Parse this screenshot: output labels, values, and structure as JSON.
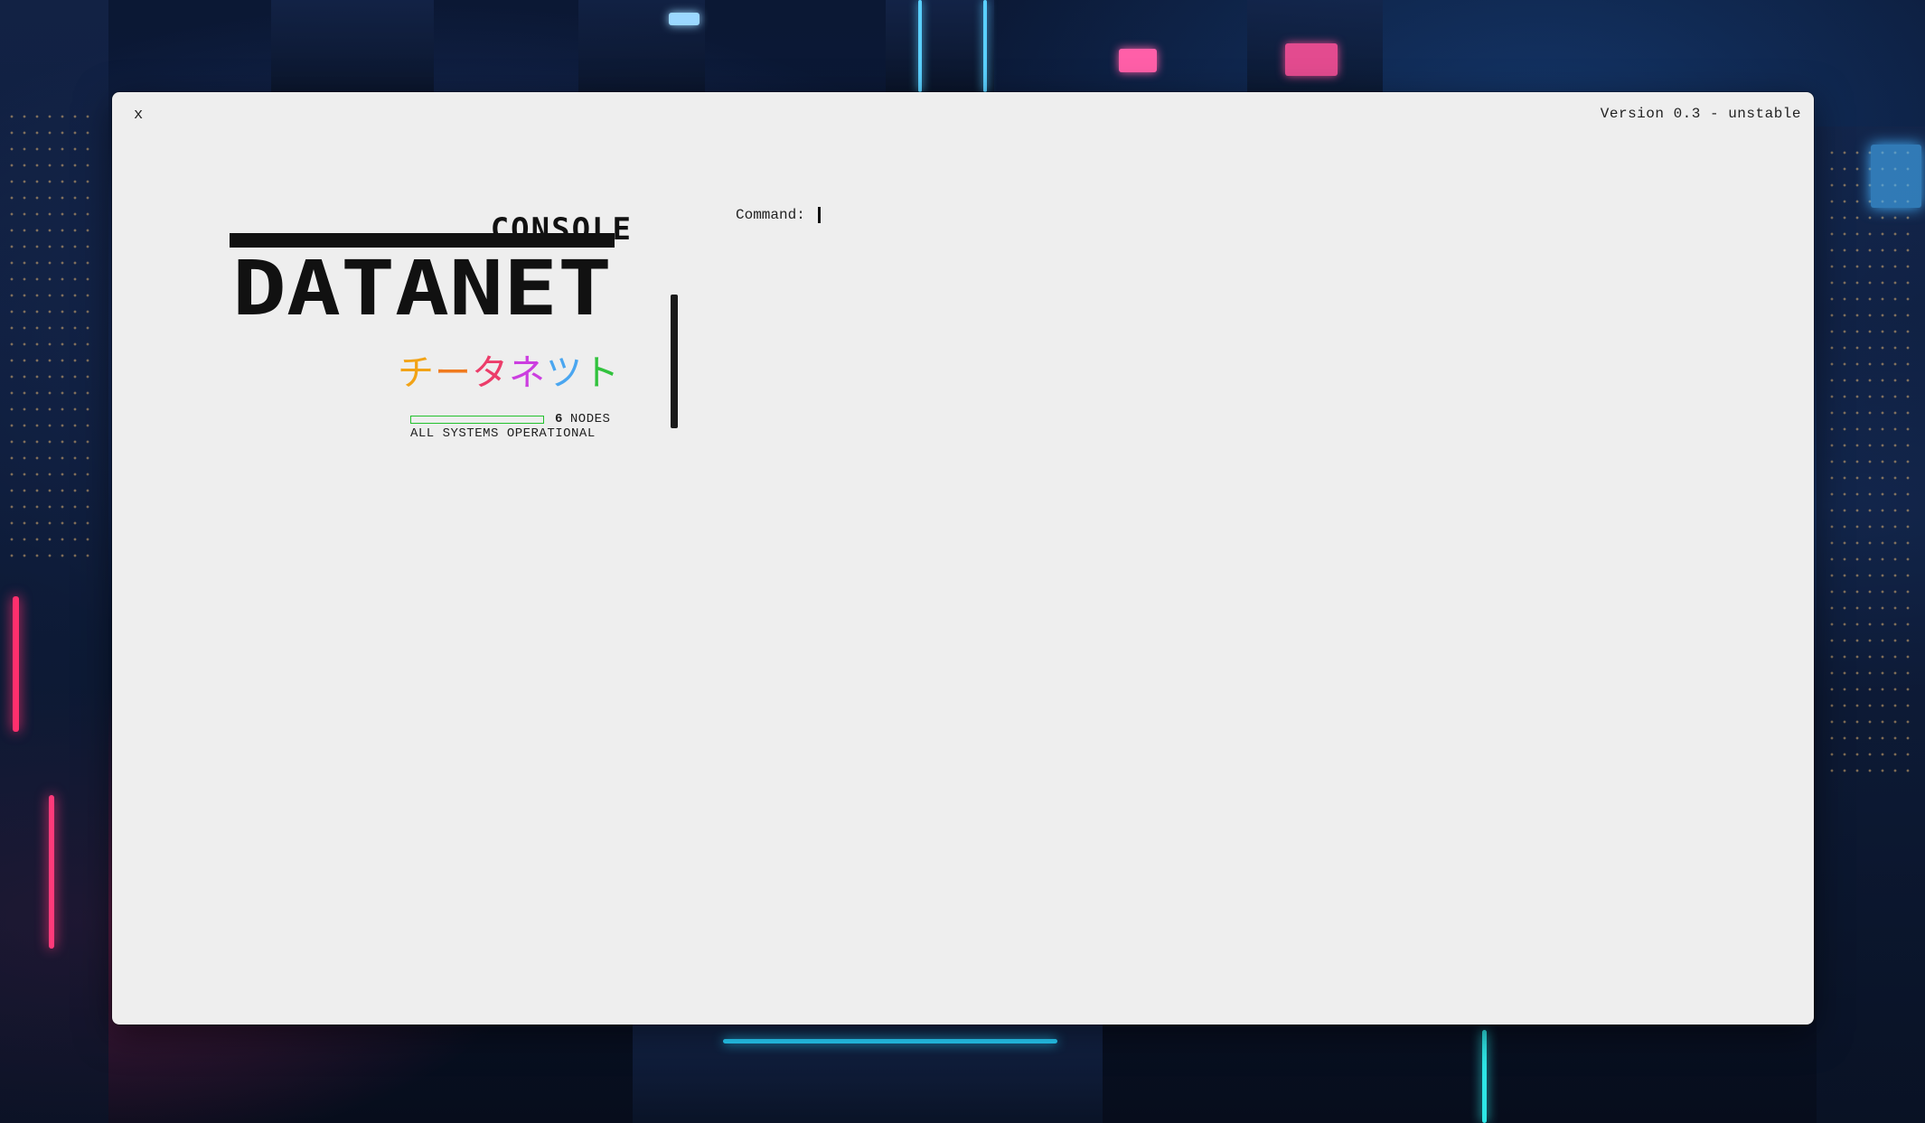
{
  "window": {
    "close_label": "x",
    "version_text": "Version 0.3 - unstable"
  },
  "logo": {
    "top_word": "CONSOLE",
    "main_word": "DATANET",
    "katakana_chars": [
      {
        "char": "チ",
        "color": "#f2a316"
      },
      {
        "char": "ー",
        "color": "#f07a1e"
      },
      {
        "char": "タ",
        "color": "#ec3d6a"
      },
      {
        "char": "ネ",
        "color": "#cc3ee0"
      },
      {
        "char": "ツ",
        "color": "#4aa6f0"
      },
      {
        "char": "ト",
        "color": "#31c23d"
      }
    ]
  },
  "status": {
    "node_count": "6",
    "nodes_label": "NODES",
    "node_fill_fraction": 0.0,
    "bar_color": "#22c12d",
    "system_status": "ALL SYSTEMS OPERATIONAL"
  },
  "command": {
    "label": "Command:",
    "value": ""
  }
}
